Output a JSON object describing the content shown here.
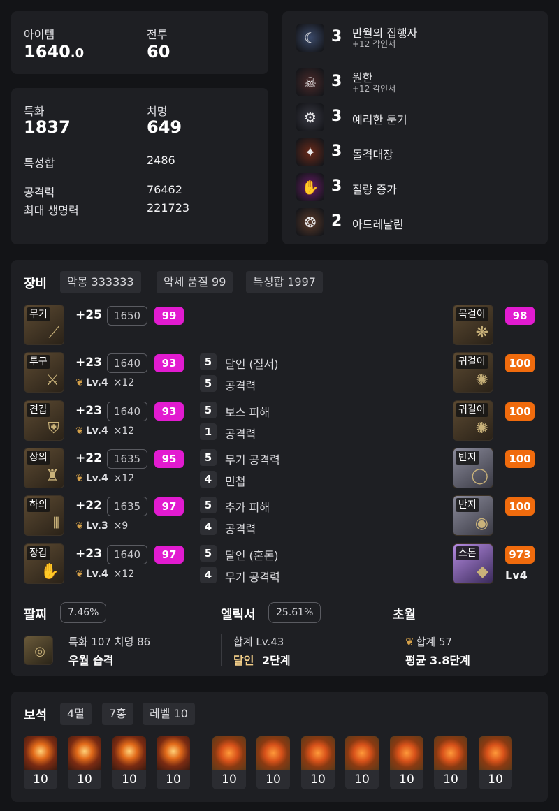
{
  "stats_top": {
    "item_label": "아이템",
    "item_value": "1640",
    "item_decimal": ".0",
    "combat_label": "전투",
    "combat_value": "60"
  },
  "stats_main": {
    "spec_label": "특화",
    "spec_value": "1837",
    "crit_label": "치명",
    "crit_value": "649",
    "sum_label": "특성합",
    "sum_value": "2486",
    "atk_label": "공격력",
    "atk_value": "76462",
    "hp_label": "최대 생명력",
    "hp_value": "221723"
  },
  "engravings": [
    {
      "level": "3",
      "name": "만월의 집행자",
      "sub": "+12 각인서",
      "icon": "moon-executor-icon",
      "color": "#3b4a6a"
    },
    {
      "level": "3",
      "name": "원한",
      "sub": "+12 각인서",
      "icon": "grudge-icon",
      "color": "#4a2a2a"
    },
    {
      "level": "3",
      "name": "예리한 둔기",
      "sub": "",
      "icon": "keen-blunt-icon",
      "color": "#3a3a44"
    },
    {
      "level": "3",
      "name": "돌격대장",
      "sub": "",
      "icon": "raid-captain-icon",
      "color": "#6a2a1a"
    },
    {
      "level": "3",
      "name": "질량 증가",
      "sub": "",
      "icon": "mass-increase-icon",
      "color": "#6a1a6a"
    },
    {
      "level": "2",
      "name": "아드레날린",
      "sub": "",
      "icon": "adrenaline-icon",
      "color": "#5a3a2a"
    }
  ],
  "equipment": {
    "title": "장비",
    "chips": [
      "악몽 333333",
      "악세 품질 99",
      "특성합 1997"
    ],
    "armor": [
      {
        "tag": "무기",
        "plus": "+25",
        "ilvl": "1650",
        "quality": "99",
        "qcolor": "pink",
        "elixir_lv": "",
        "elixir_x": "",
        "opt1_num": "",
        "opt1": "",
        "opt2_num": "",
        "opt2": ""
      },
      {
        "tag": "투구",
        "plus": "+23",
        "ilvl": "1640",
        "quality": "93",
        "qcolor": "pink",
        "elixir_lv": "Lv.4",
        "elixir_x": "×12",
        "opt1_num": "5",
        "opt1": "달인 (질서)",
        "opt2_num": "5",
        "opt2": "공격력"
      },
      {
        "tag": "견갑",
        "plus": "+23",
        "ilvl": "1640",
        "quality": "93",
        "qcolor": "pink",
        "elixir_lv": "Lv.4",
        "elixir_x": "×12",
        "opt1_num": "5",
        "opt1": "보스 피해",
        "opt2_num": "1",
        "opt2": "공격력"
      },
      {
        "tag": "상의",
        "plus": "+22",
        "ilvl": "1635",
        "quality": "95",
        "qcolor": "pink",
        "elixir_lv": "Lv.4",
        "elixir_x": "×12",
        "opt1_num": "5",
        "opt1": "무기 공격력",
        "opt2_num": "4",
        "opt2": "민첩"
      },
      {
        "tag": "하의",
        "plus": "+22",
        "ilvl": "1635",
        "quality": "97",
        "qcolor": "pink",
        "elixir_lv": "Lv.3",
        "elixir_x": "×9",
        "opt1_num": "5",
        "opt1": "추가 피해",
        "opt2_num": "4",
        "opt2": "공격력"
      },
      {
        "tag": "장갑",
        "plus": "+23",
        "ilvl": "1640",
        "quality": "97",
        "qcolor": "pink",
        "elixir_lv": "Lv.4",
        "elixir_x": "×12",
        "opt1_num": "5",
        "opt1": "달인 (혼돈)",
        "opt2_num": "4",
        "opt2": "무기 공격력"
      }
    ],
    "accessories": [
      {
        "tag": "목걸이",
        "quality": "98",
        "qcolor": "pink"
      },
      {
        "tag": "귀걸이",
        "quality": "100",
        "qcolor": "orange"
      },
      {
        "tag": "귀걸이",
        "quality": "100",
        "qcolor": "orange"
      },
      {
        "tag": "반지",
        "quality": "100",
        "qcolor": "orange"
      },
      {
        "tag": "반지",
        "quality": "100",
        "qcolor": "orange"
      },
      {
        "tag": "스톤",
        "quality": "973",
        "qcolor": "orange",
        "extra": "Lv4"
      }
    ],
    "bracelet": {
      "title": "팔찌",
      "percent": "7.46%",
      "line1": "특화 107  치명 86",
      "line2": "우월  습격"
    },
    "elixir": {
      "title": "엘릭서",
      "percent": "25.61%",
      "line1": "합계 Lv.43",
      "line2_a": "달인",
      "line2_b": "2단계"
    },
    "transcend": {
      "title": "초월",
      "line1": "합계 57",
      "line2": "평균 3.8단계"
    }
  },
  "gems": {
    "title": "보석",
    "chips": [
      "4멸",
      "7홍",
      "레벨 10"
    ],
    "items": [
      {
        "type": "멸",
        "level": "10"
      },
      {
        "type": "멸",
        "level": "10"
      },
      {
        "type": "멸",
        "level": "10"
      },
      {
        "type": "멸",
        "level": "10"
      },
      {
        "type": "홍",
        "level": "10"
      },
      {
        "type": "홍",
        "level": "10"
      },
      {
        "type": "홍",
        "level": "10"
      },
      {
        "type": "홍",
        "level": "10"
      },
      {
        "type": "홍",
        "level": "10"
      },
      {
        "type": "홍",
        "level": "10"
      },
      {
        "type": "홍",
        "level": "10"
      }
    ]
  },
  "colors": {
    "quality_pink": "#e21bd0",
    "quality_orange": "#f06b0d",
    "elixir_accent": "#f5d08a"
  }
}
